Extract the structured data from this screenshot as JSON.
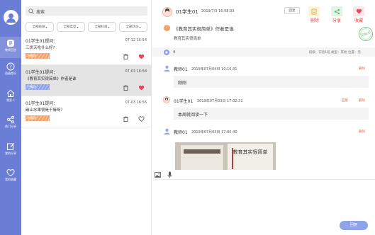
{
  "sidebar": {
    "items": [
      {
        "label": "教师回答",
        "icon": "file-icon"
      },
      {
        "label": "班级提问",
        "icon": "question-icon"
      },
      {
        "label": "我家人",
        "icon": "home-icon"
      },
      {
        "label": "热门分享",
        "icon": "share-icon"
      },
      {
        "label": "我的分享",
        "icon": "edit-share-icon"
      },
      {
        "label": "我的收藏",
        "icon": "heart-icon"
      }
    ]
  },
  "list": {
    "search_placeholder": "搜索",
    "filters": [
      "全部班级",
      "全部类型",
      "全部科目",
      "全部状态"
    ],
    "items": [
      {
        "who": "01学生01提问：",
        "time": "07-12 15:54",
        "question": "三伏天吃什么好?",
        "status": "未解决",
        "status_color": "#f5a36c",
        "favorited": true
      },
      {
        "who": "01学生01提问：",
        "time": "07-03 16:58",
        "question": "《教育其实很简单》作者是谁",
        "status": "已解决",
        "status_color": "#8fa4e8",
        "favorited": true
      },
      {
        "who": "01学生01提问：",
        "time": "07-03 16:56",
        "question": "碳山水果很是干嘛呀？",
        "status": "未解决",
        "status_color": "#f5a36c",
        "favorited": false
      }
    ]
  },
  "detail": {
    "asker": "01学生01",
    "time": "2019/7/3 16:58:33",
    "reply_button": "回复",
    "actions": {
      "delete": "删除",
      "share": "分享",
      "favorite": "收藏"
    },
    "question_title": "《教育其实很简单》作者是谁",
    "question_body": "教育其实很简单",
    "stamp_text": "已解决",
    "answer_count": "4",
    "meta": "班级：实验1班    类型：其他    位置：无",
    "replies": [
      {
        "name": "教师01",
        "time": "2019年07月04日 10:10:31",
        "text": "刚刚",
        "delete": "删除"
      },
      {
        "name": "01学生01",
        "time": "2019年07月03日 17:02:31",
        "text": "本周就阅读一下",
        "reply": "回复",
        "delete": "删除"
      },
      {
        "name": "教师01",
        "time": "2019年07月03日 17:00:40",
        "delete": "删除"
      }
    ],
    "photo_text": "教育其实很简单",
    "submit": "回复"
  },
  "colors": {
    "accent": "#6a7ed6",
    "danger": "#e04646",
    "unsolved": "#f5a36c",
    "solved": "#8fa4e8"
  }
}
